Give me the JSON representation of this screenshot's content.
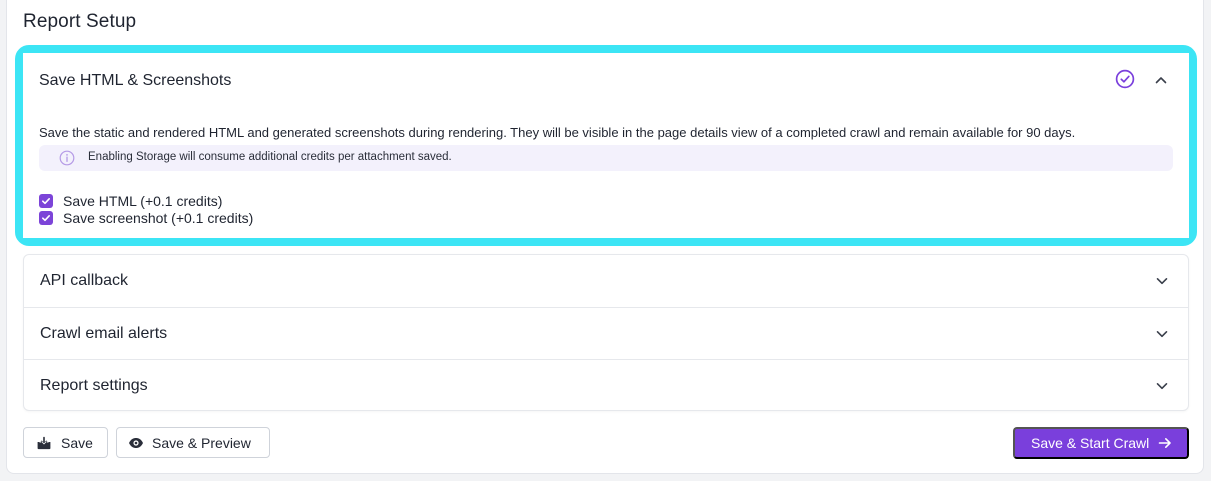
{
  "page": {
    "title": "Report Setup"
  },
  "storage_panel": {
    "title": "Save HTML & Screenshots",
    "status_icon": "check-circle-icon",
    "toggle_icon": "chevron-up-icon",
    "description": "Save the static and rendered HTML and generated screenshots during rendering. They will be visible in the page details view of a completed crawl and remain available for 90 days.",
    "info": {
      "icon": "info-icon",
      "text": "Enabling Storage will consume additional credits per attachment saved."
    },
    "options": [
      {
        "label": "Save HTML (+0.1 credits)",
        "checked": true
      },
      {
        "label": "Save screenshot (+0.1 credits)",
        "checked": true
      }
    ]
  },
  "collapsed_panels": [
    {
      "label": "API callback",
      "toggle_icon": "chevron-down-icon"
    },
    {
      "label": "Crawl email alerts",
      "toggle_icon": "chevron-down-icon"
    },
    {
      "label": "Report settings",
      "toggle_icon": "chevron-down-icon"
    }
  ],
  "actions": {
    "save": {
      "label": "Save",
      "icon": "save-icon"
    },
    "save_preview": {
      "label": "Save & Preview",
      "icon": "eye-icon"
    },
    "save_start": {
      "label": "Save & Start Crawl",
      "icon": "arrow-right-icon"
    }
  },
  "colors": {
    "accent": "#7a3fdc",
    "highlight": "#3ce5f5",
    "info_bg": "#f3f1fc"
  }
}
